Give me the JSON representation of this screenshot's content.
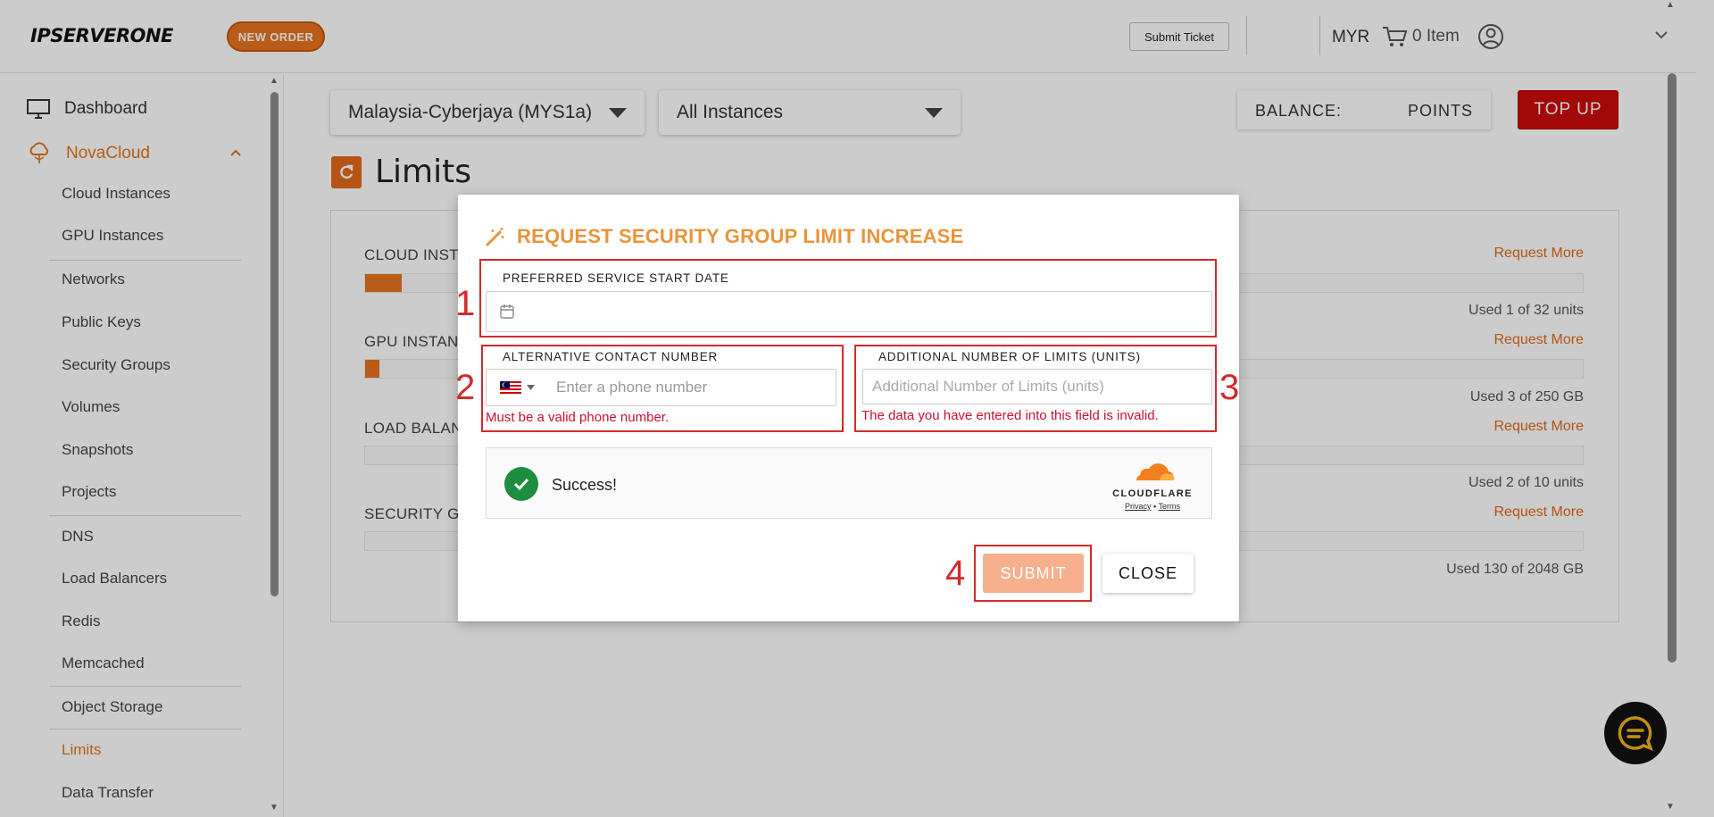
{
  "header": {
    "logo": "IPSERVERONE",
    "new_order_label": "NEW ORDER",
    "submit_ticket_label": "Submit Ticket",
    "currency": "MYR",
    "cart_label": "0 Item"
  },
  "sidebar": {
    "dashboard": "Dashboard",
    "novacloud": "NovaCloud",
    "items": [
      "Cloud Instances",
      "GPU Instances",
      "Networks",
      "Public Keys",
      "Security Groups",
      "Volumes",
      "Snapshots",
      "Projects",
      "DNS",
      "Load Balancers",
      "Redis",
      "Memcached",
      "Object Storage",
      "Limits",
      "Data Transfer"
    ],
    "active_item": "Limits"
  },
  "main": {
    "region_select": "Malaysia-Cyberjaya (MYS1a)",
    "instance_select": "All Instances",
    "balance_label": "BALANCE:",
    "balance_points": "POINTS",
    "topup_label": "TOP UP",
    "page_title": "Limits",
    "resources": [
      {
        "label": "CLOUD INST",
        "fill": 0.03,
        "request": "Request More",
        "used": "Used 1 of 32 units"
      },
      {
        "label": "GPU INSTAN",
        "fill": 0.012,
        "request": "Request More",
        "used": "Used 3 of 250 GB"
      },
      {
        "label": "LOAD BALAN",
        "fill": 0.0,
        "request": "Request More",
        "used": "Used 2 of 10 units"
      },
      {
        "label": "SECURITY GR",
        "fill": 0.0,
        "request": "Request More",
        "used": "Used 130 of 2048 GB"
      }
    ]
  },
  "modal": {
    "title": "REQUEST SECURITY GROUP LIMIT INCREASE",
    "start_date_label": "PREFERRED SERVICE START DATE",
    "start_date_value": "",
    "phone_label": "ALTERNATIVE CONTACT NUMBER",
    "phone_placeholder": "Enter a phone number",
    "phone_error": "Must be a valid phone number.",
    "limits_label": "ADDITIONAL NUMBER OF LIMITS (UNITS)",
    "limits_placeholder": "Additional Number of Limits (units)",
    "limits_error": "The data you have entered into this field is invalid.",
    "captcha_status": "Success!",
    "captcha_brand": "CLOUDFLARE",
    "captcha_privacy": "Privacy",
    "captcha_sep": "•",
    "captcha_terms": "Terms",
    "submit_label": "SUBMIT",
    "close_label": "CLOSE",
    "annotations": [
      "1",
      "2",
      "3",
      "4"
    ]
  },
  "colors": {
    "accent": "#e8731f",
    "topup": "#cc0a0a",
    "modal_title": "#e8943a",
    "error": "#c8102e",
    "annotation": "#d42a2a",
    "success": "#1e8e3e"
  }
}
